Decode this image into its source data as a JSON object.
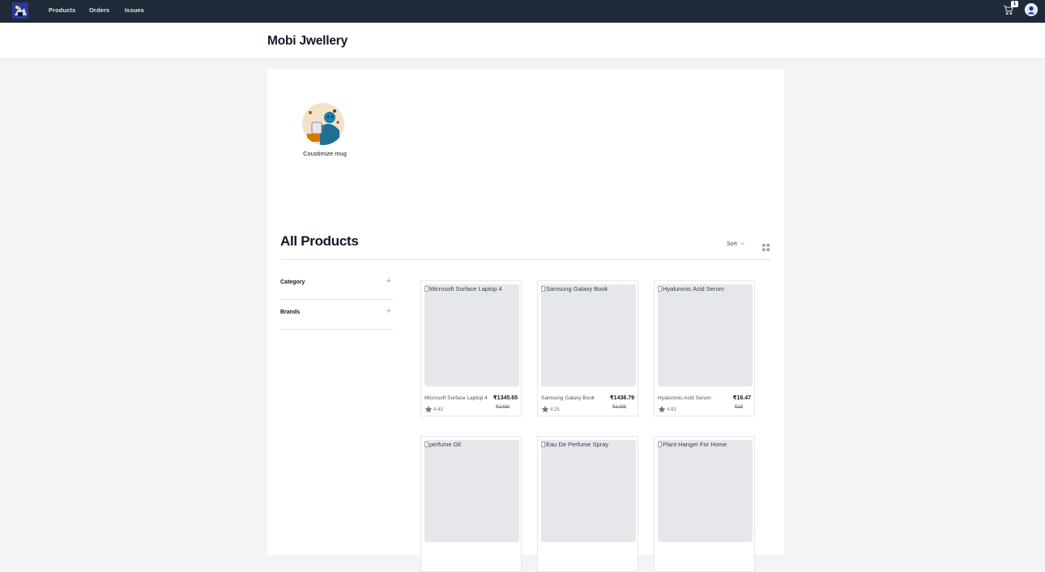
{
  "nav": {
    "links": [
      "Products",
      "Orders",
      "Issues"
    ],
    "cart_count": "1",
    "icons": [
      "logo-icon",
      "cart-icon",
      "avatar-icon"
    ]
  },
  "store": {
    "title": "Mobi Jwellery"
  },
  "categories": [
    {
      "label": "Coustimize mug"
    }
  ],
  "products_section": {
    "title": "All Products",
    "sort_label": "Sort",
    "filters": [
      "Category",
      "Brands"
    ]
  },
  "products": [
    {
      "alt": "Microsoft Surface Laptop 4",
      "name": "Microsoft Surface Laptop 4",
      "price": "₹1345.65",
      "mrp": "₹1499",
      "rating": "4.43"
    },
    {
      "alt": "Samsung Galaxy Book",
      "name": "Samsung Galaxy Book",
      "price": "₹1436.79",
      "mrp": "₹1499",
      "rating": "4.25"
    },
    {
      "alt": "Hyaluronic Acid Serum",
      "name": "Hyaluronic Acid Serum",
      "price": "₹16.47",
      "mrp": "₹19",
      "rating": "4.83"
    },
    {
      "alt": "perfume Oil"
    },
    {
      "alt": "Eau De Perfume Spray"
    },
    {
      "alt": "Plant Hanger For Home"
    }
  ],
  "colors": {
    "nav_bg": "#1f2937",
    "page_bg": "#f3f4f6",
    "card_bg": "#ffffff",
    "img_placeholder": "#e5e7eb"
  }
}
